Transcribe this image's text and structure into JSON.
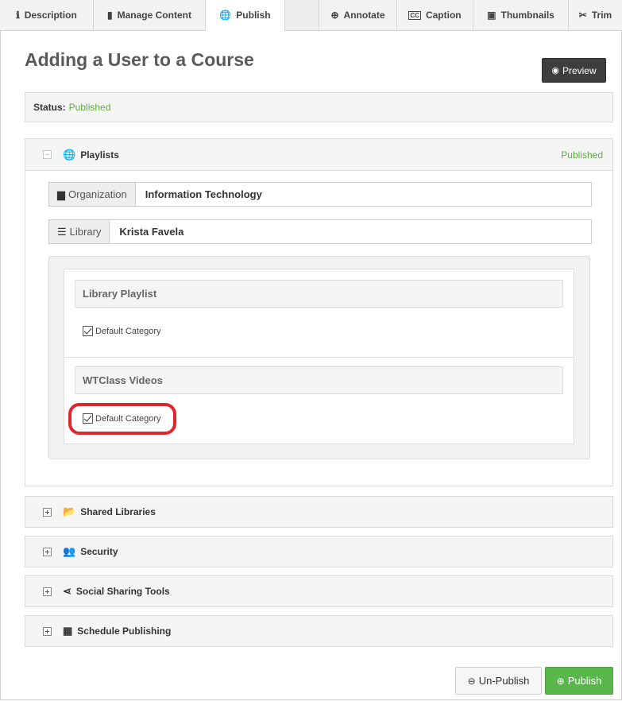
{
  "tabs": [
    {
      "label": "Description",
      "icon": "info-icon",
      "glyph": "ℹ"
    },
    {
      "label": "Manage Content",
      "icon": "file-icon",
      "glyph": "▮"
    },
    {
      "label": "Publish",
      "icon": "globe-icon",
      "glyph": "●"
    },
    {
      "label": "",
      "icon": "",
      "glyph": ""
    },
    {
      "label": "Annotate",
      "icon": "search-plus-icon",
      "glyph": "⊕"
    },
    {
      "label": "Caption",
      "icon": "closed-caption-icon",
      "glyph": "㏄"
    },
    {
      "label": "Thumbnails",
      "icon": "image-icon",
      "glyph": "▣"
    },
    {
      "label": "Trim",
      "icon": "scissors-icon",
      "glyph": "✂"
    }
  ],
  "page": {
    "title": "Adding a User to a Course",
    "preview_label": "Preview"
  },
  "status": {
    "label": "Status:",
    "value": "Published"
  },
  "playlists": {
    "title": "Playlists",
    "status": "Published",
    "organization_label": "Organization",
    "organization_value": "Information Technology",
    "library_label": "Library",
    "library_value": "Krista Favela",
    "groups": [
      {
        "title": "Library Playlist",
        "category": "Default Category"
      },
      {
        "title": "WTClass Videos",
        "category": "Default Category"
      }
    ]
  },
  "sections": {
    "shared": "Shared Libraries",
    "security": "Security",
    "social": "Social Sharing Tools",
    "schedule": "Schedule Publishing"
  },
  "actions": {
    "unpublish": "Un-Publish",
    "publish": "Publish"
  },
  "colors": {
    "accent_green": "#5cae3b",
    "highlight_red": "#e0262b",
    "preview_dark": "#3e3e3e"
  }
}
